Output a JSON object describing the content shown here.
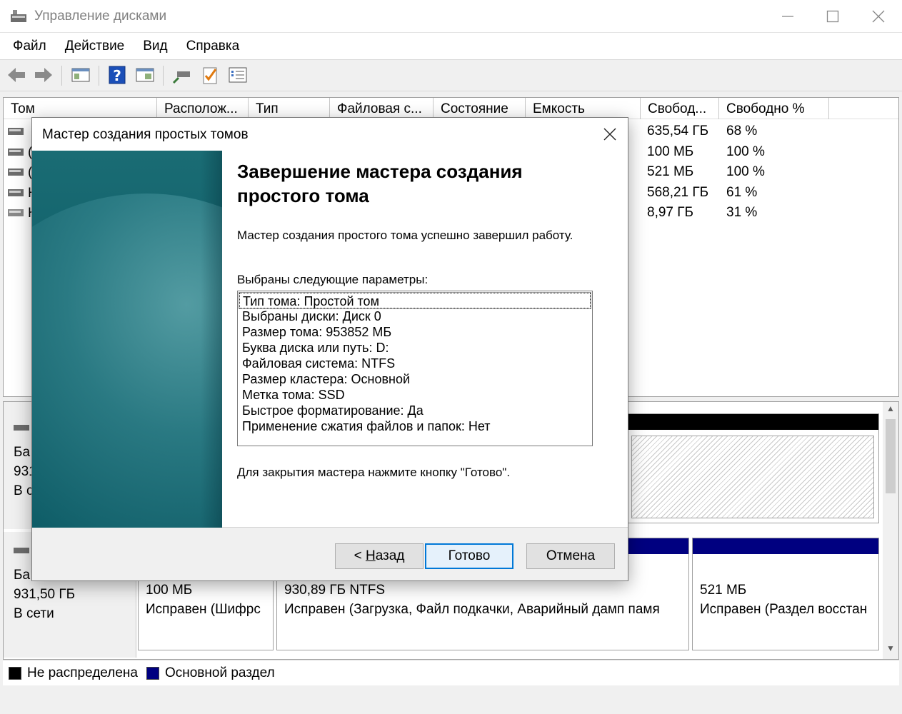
{
  "window": {
    "title": "Управление дисками"
  },
  "menu": [
    "Файл",
    "Действие",
    "Вид",
    "Справка"
  ],
  "toolbar_icons": [
    "back-arrow-icon",
    "forward-arrow-icon",
    "console-tree-icon",
    "help-icon",
    "properties-icon",
    "connect-icon",
    "check-icon",
    "settings-list-icon"
  ],
  "volume_table": {
    "columns": [
      "Том",
      "Располож...",
      "Тип",
      "Файловая с...",
      "Состояние",
      "Емкость",
      "Свобод...",
      "Свободно %"
    ],
    "rows": [
      {
        "name": "",
        "free": "635,54 ГБ",
        "free_pct": "68 %"
      },
      {
        "name": "(",
        "free": "100 МБ",
        "free_pct": "100 %"
      },
      {
        "name": "(",
        "free": "521 МБ",
        "free_pct": "100 %"
      },
      {
        "name": "Н",
        "free": "568,21 ГБ",
        "free_pct": "61 %"
      },
      {
        "name": "К",
        "free": "8,97 ГБ",
        "free_pct": "31 %"
      }
    ]
  },
  "disks": [
    {
      "label_lines": [
        "Ба",
        "931",
        "В с"
      ]
    },
    {
      "label_lines": [
        "Ба",
        "931,50 ГБ",
        "В сети"
      ],
      "partitions": [
        {
          "size": "100 МБ",
          "status": "Исправен (Шифрс"
        },
        {
          "size": "930,89 ГБ NTFS",
          "status": "Исправен (Загрузка, Файл подкачки, Аварийный дамп памя"
        },
        {
          "size": "521 МБ",
          "status": "Исправен (Раздел восстан"
        }
      ]
    }
  ],
  "legend": [
    {
      "label": "Не распределена",
      "color": "#000000"
    },
    {
      "label": "Основной раздел",
      "color": "#000080"
    }
  ],
  "dialog": {
    "title": "Мастер создания простых томов",
    "heading": "Завершение мастера создания простого тома",
    "success_text": "Мастер создания простого тома успешно завершил работу.",
    "params_label": "Выбраны следующие параметры:",
    "params": [
      "Тип тома: Простой том",
      "Выбраны диски: Диск 0",
      "Размер тома: 953852 МБ",
      "Буква диска или путь: D:",
      "Файловая система: NTFS",
      "Размер кластера: Основной",
      "Метка тома: SSD",
      "Быстрое форматирование: Да",
      "Применение сжатия файлов и папок: Нет"
    ],
    "close_hint": "Для закрытия мастера нажмите кнопку \"Готово\".",
    "buttons": {
      "back_prefix": "< ",
      "back_accel": "Н",
      "back_rest": "азад",
      "finish": "Готово",
      "cancel": "Отмена"
    }
  },
  "colors": {
    "unallocated": "#000000",
    "primary_partition": "#000080",
    "default_button_border": "#0078d7"
  }
}
